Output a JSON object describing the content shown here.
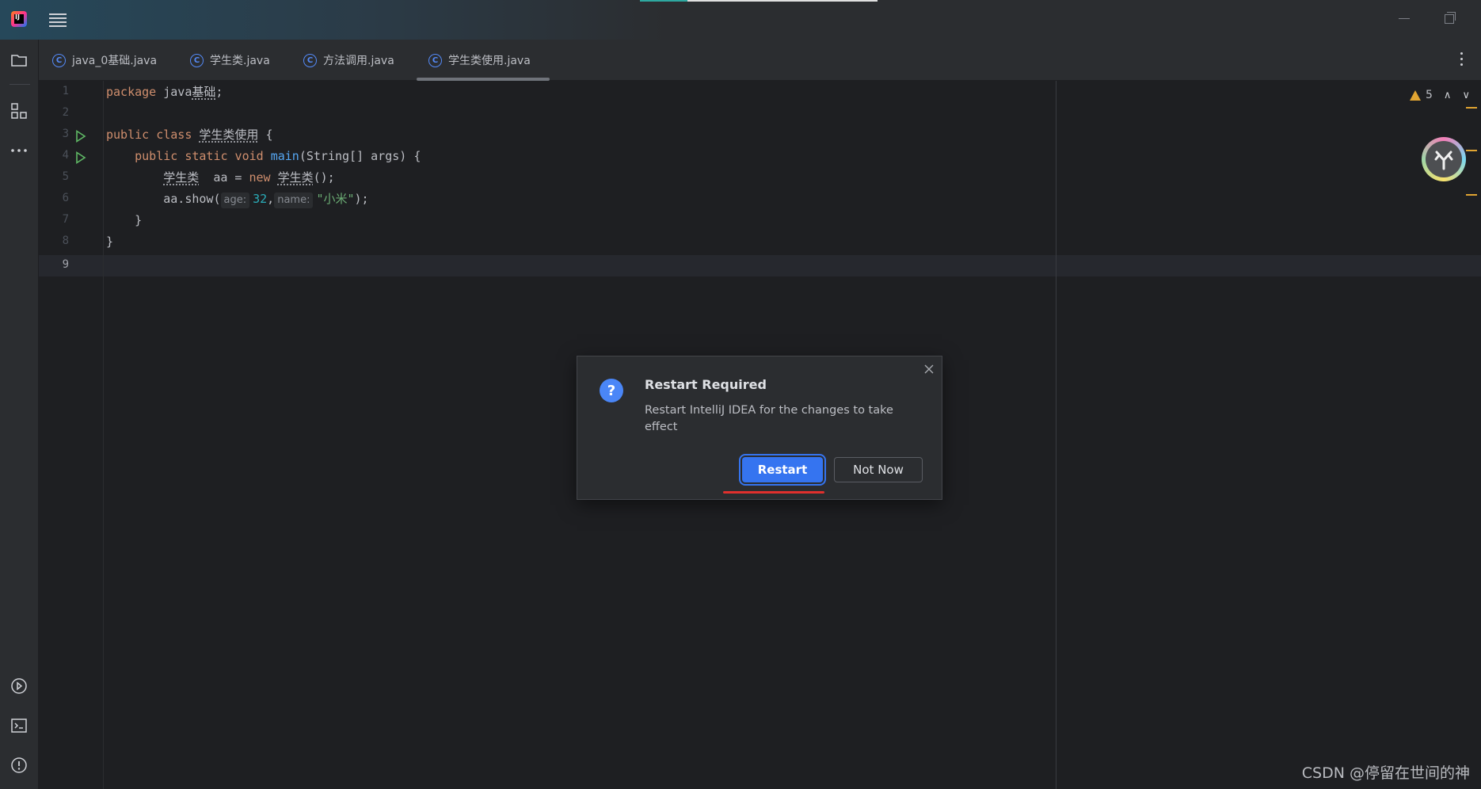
{
  "window": {
    "title": "IntelliJ IDEA"
  },
  "tabs": [
    {
      "label": "java_0基础.java",
      "icon": "class-icon"
    },
    {
      "label": "学生类.java",
      "icon": "class-icon"
    },
    {
      "label": "方法调用.java",
      "icon": "class-icon"
    },
    {
      "label": "学生类使用.java",
      "icon": "class-icon",
      "active": true
    }
  ],
  "tab_class_glyph": "C",
  "editor": {
    "line_numbers": [
      "1",
      "2",
      "3",
      "4",
      "5",
      "6",
      "7",
      "8",
      "9"
    ],
    "current_line": 9,
    "code": {
      "l1_kw": "package",
      "l1_pkg": "java",
      "l1_pkg_cn": "基础",
      "l1_end": ";",
      "l3_kw": "public class",
      "l3_cls": "学生类使用",
      "l3_end": "{",
      "l4_kw": "public static void",
      "l4_fn": "main",
      "l4_rest": "(String[] args) {",
      "l5_type": "学生类",
      "l5_var": "  aa = ",
      "l5_new": "new",
      "l5_ctor": "学生类",
      "l5_end": "();",
      "l6_call": "aa.show(",
      "l6_hint1": "age:",
      "l6_num": "32",
      "l6_comma": ",",
      "l6_hint2": "name:",
      "l6_str": "\"小米\"",
      "l6_end": ");",
      "l7": "}",
      "l8": "}"
    },
    "inspections": {
      "warning_count": "5",
      "up": "∧",
      "down": "∨"
    }
  },
  "dialog": {
    "title": "Restart Required",
    "message": "Restart IntelliJ IDEA for the changes to take effect",
    "icon_glyph": "?",
    "primary_button": "Restart",
    "secondary_button": "Not Now"
  },
  "watermark": "CSDN @停留在世间的神",
  "colors": {
    "accent": "#3574f0",
    "warning": "#e0a432",
    "keyword": "#cf8e6d",
    "function": "#56a8f5",
    "number": "#2aacb8",
    "string": "#6aab73",
    "annotation_underline": "#e0302d"
  }
}
